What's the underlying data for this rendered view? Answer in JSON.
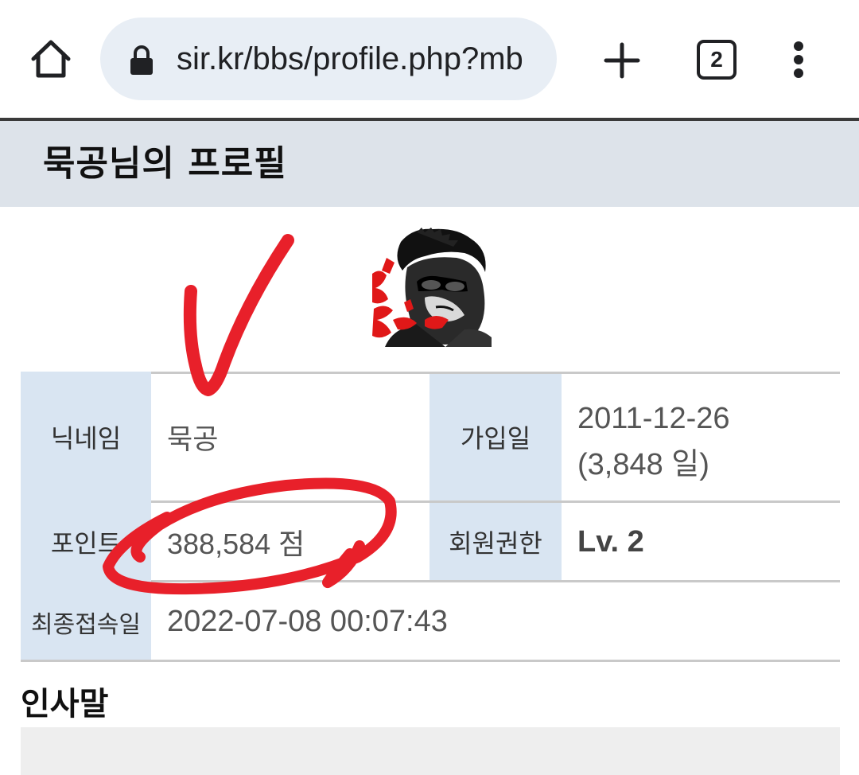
{
  "browser": {
    "url": "sir.kr/bbs/profile.php?mb",
    "tab_count": "2",
    "icons": [
      "home-icon",
      "lock-icon",
      "plus-icon",
      "tab-switcher-icon",
      "more-vert-icon"
    ]
  },
  "page": {
    "title": "묵공님의 프로필"
  },
  "profile": {
    "nickname_label": "닉네임",
    "nickname_value": "묵공",
    "join_label": "가입일",
    "join_date": "2011-12-26",
    "join_days": "(3,848 일)",
    "points_label": "포인트",
    "points_value": "388,584 점",
    "level_label": "회원권한",
    "level_value": "Lv. 2",
    "last_login_label": "최종접속일",
    "last_login_value": "2022-07-08 00:07:43"
  },
  "greeting": {
    "title": "인사말"
  },
  "colors": {
    "header_bg": "#dde3ea",
    "label_cell_bg": "#d9e5f2",
    "urlbar_bg": "#e8eef5",
    "annotation_red": "#e8202a"
  }
}
